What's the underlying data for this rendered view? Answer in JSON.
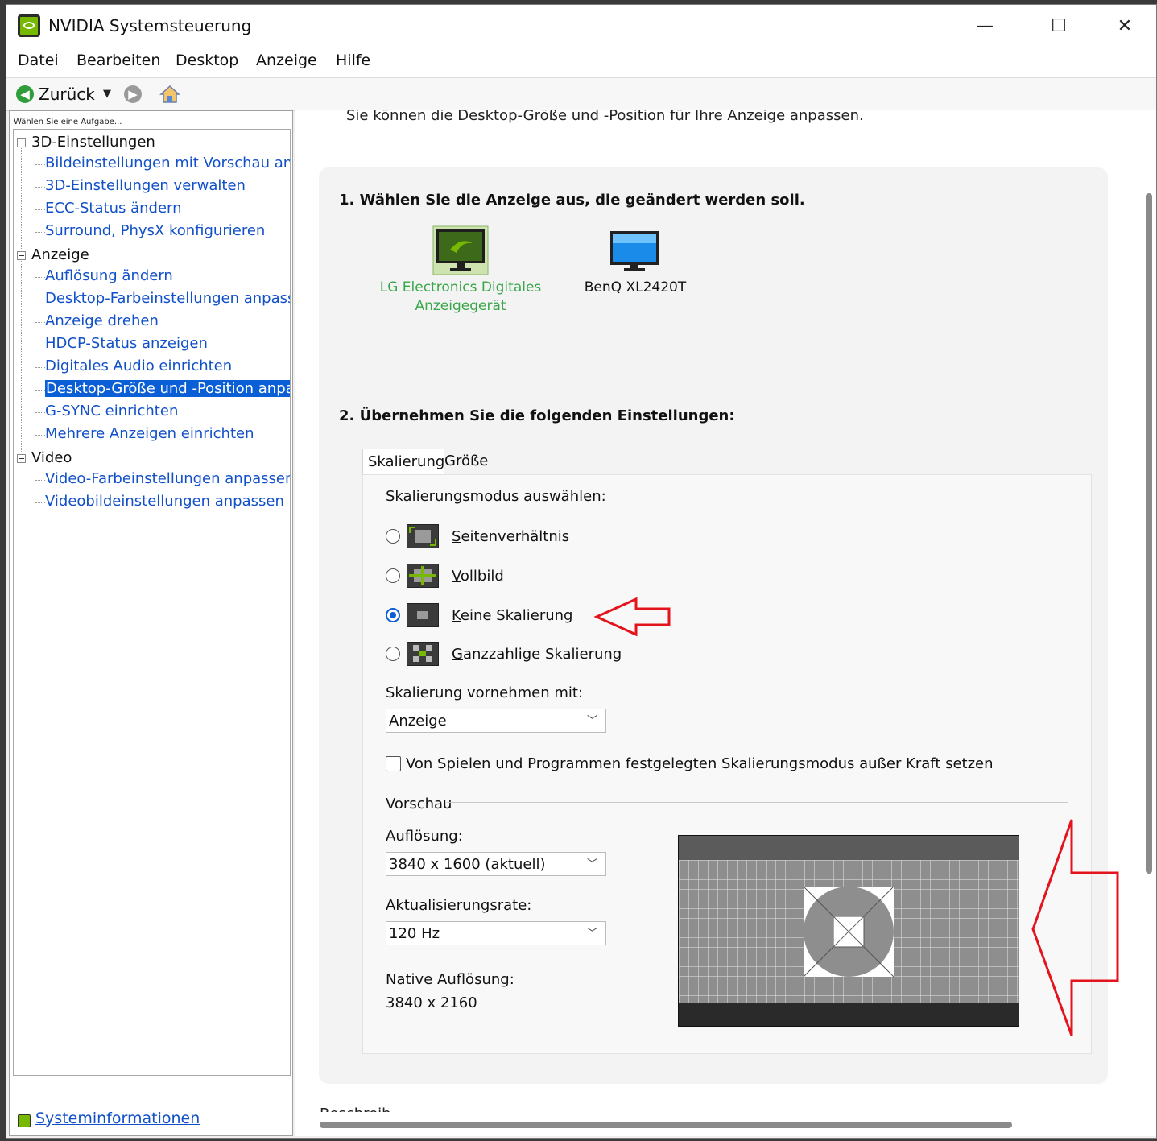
{
  "window": {
    "title": "NVIDIA Systemsteuerung",
    "minimize": "—",
    "maximize": "☐",
    "close": "✕"
  },
  "menu": [
    "Datei",
    "Bearbeiten",
    "Desktop",
    "Anzeige",
    "Hilfe"
  ],
  "toolbar": {
    "back_label": "Zurück",
    "back_icon": "back-arrow-icon",
    "forward_icon": "forward-arrow-icon",
    "home_icon": "home-icon"
  },
  "sidebar": {
    "caption": "Wählen Sie eine Aufgabe...",
    "categories": [
      {
        "label": "3D-Einstellungen",
        "items": [
          "Bildeinstellungen mit Vorschau anpa",
          "3D-Einstellungen verwalten",
          "ECC-Status ändern",
          "Surround, PhysX konfigurieren"
        ]
      },
      {
        "label": "Anzeige",
        "items": [
          "Auflösung ändern",
          "Desktop-Farbeinstellungen anpasser",
          "Anzeige drehen",
          "HDCP-Status anzeigen",
          "Digitales Audio einrichten",
          "Desktop-Größe und -Position anpass",
          "G-SYNC einrichten",
          "Mehrere Anzeigen einrichten"
        ]
      },
      {
        "label": "Video",
        "items": [
          "Video-Farbeinstellungen anpassen",
          "Videobildeinstellungen anpassen"
        ]
      }
    ],
    "selected_item": "Desktop-Größe und -Position anpass",
    "system_info": "Systeminformationen"
  },
  "main": {
    "intro": "Sie können die Desktop-Größe und -Position für Ihre Anzeige anpassen.",
    "step1": "1. Wählen Sie die Anzeige aus, die geändert werden soll.",
    "displays": [
      {
        "line1": "LG Electronics Digitales",
        "line2": "Anzeigegerät",
        "selected": true,
        "color": "#3aa64a"
      },
      {
        "line1": "BenQ XL2420T",
        "line2": "",
        "selected": false,
        "color": "#111111"
      }
    ],
    "step2": "2. Übernehmen Sie die folgenden Einstellungen:",
    "tabs": [
      "Skalierung",
      "Größe"
    ],
    "active_tab": "Skalierung",
    "scaling": {
      "mode_label": "Skalierungsmodus auswählen:",
      "options": [
        {
          "underline": "S",
          "rest": "eitenverhältnis",
          "selected": false
        },
        {
          "underline": "V",
          "rest": "ollbild",
          "selected": false
        },
        {
          "underline": "K",
          "rest": "eine Skalierung",
          "selected": true
        },
        {
          "underline": "G",
          "rest": "anzzahlige Skalierung",
          "selected": false
        }
      ],
      "perform_label": "Skalierung vornehmen mit:",
      "perform_value": "Anzeige",
      "override_label": "Von Spielen und Programmen festgelegten Skalierungsmodus außer Kraft setzen",
      "override_checked": false
    },
    "preview": {
      "section_label": "Vorschau",
      "resolution_label": "Auflösung:",
      "resolution_value": "3840 x 1600 (aktuell)",
      "refresh_label": "Aktualisierungsrate:",
      "refresh_value": "120 Hz",
      "native_label": "Native Auflösung:",
      "native_value": "3840 x 2160"
    },
    "clipped_text": "Beschreib"
  },
  "colors": {
    "nvidia_green": "#76b900",
    "selection_blue": "#0a5fd6",
    "link_blue": "#1150c8",
    "annotation_red": "#e3141d"
  }
}
